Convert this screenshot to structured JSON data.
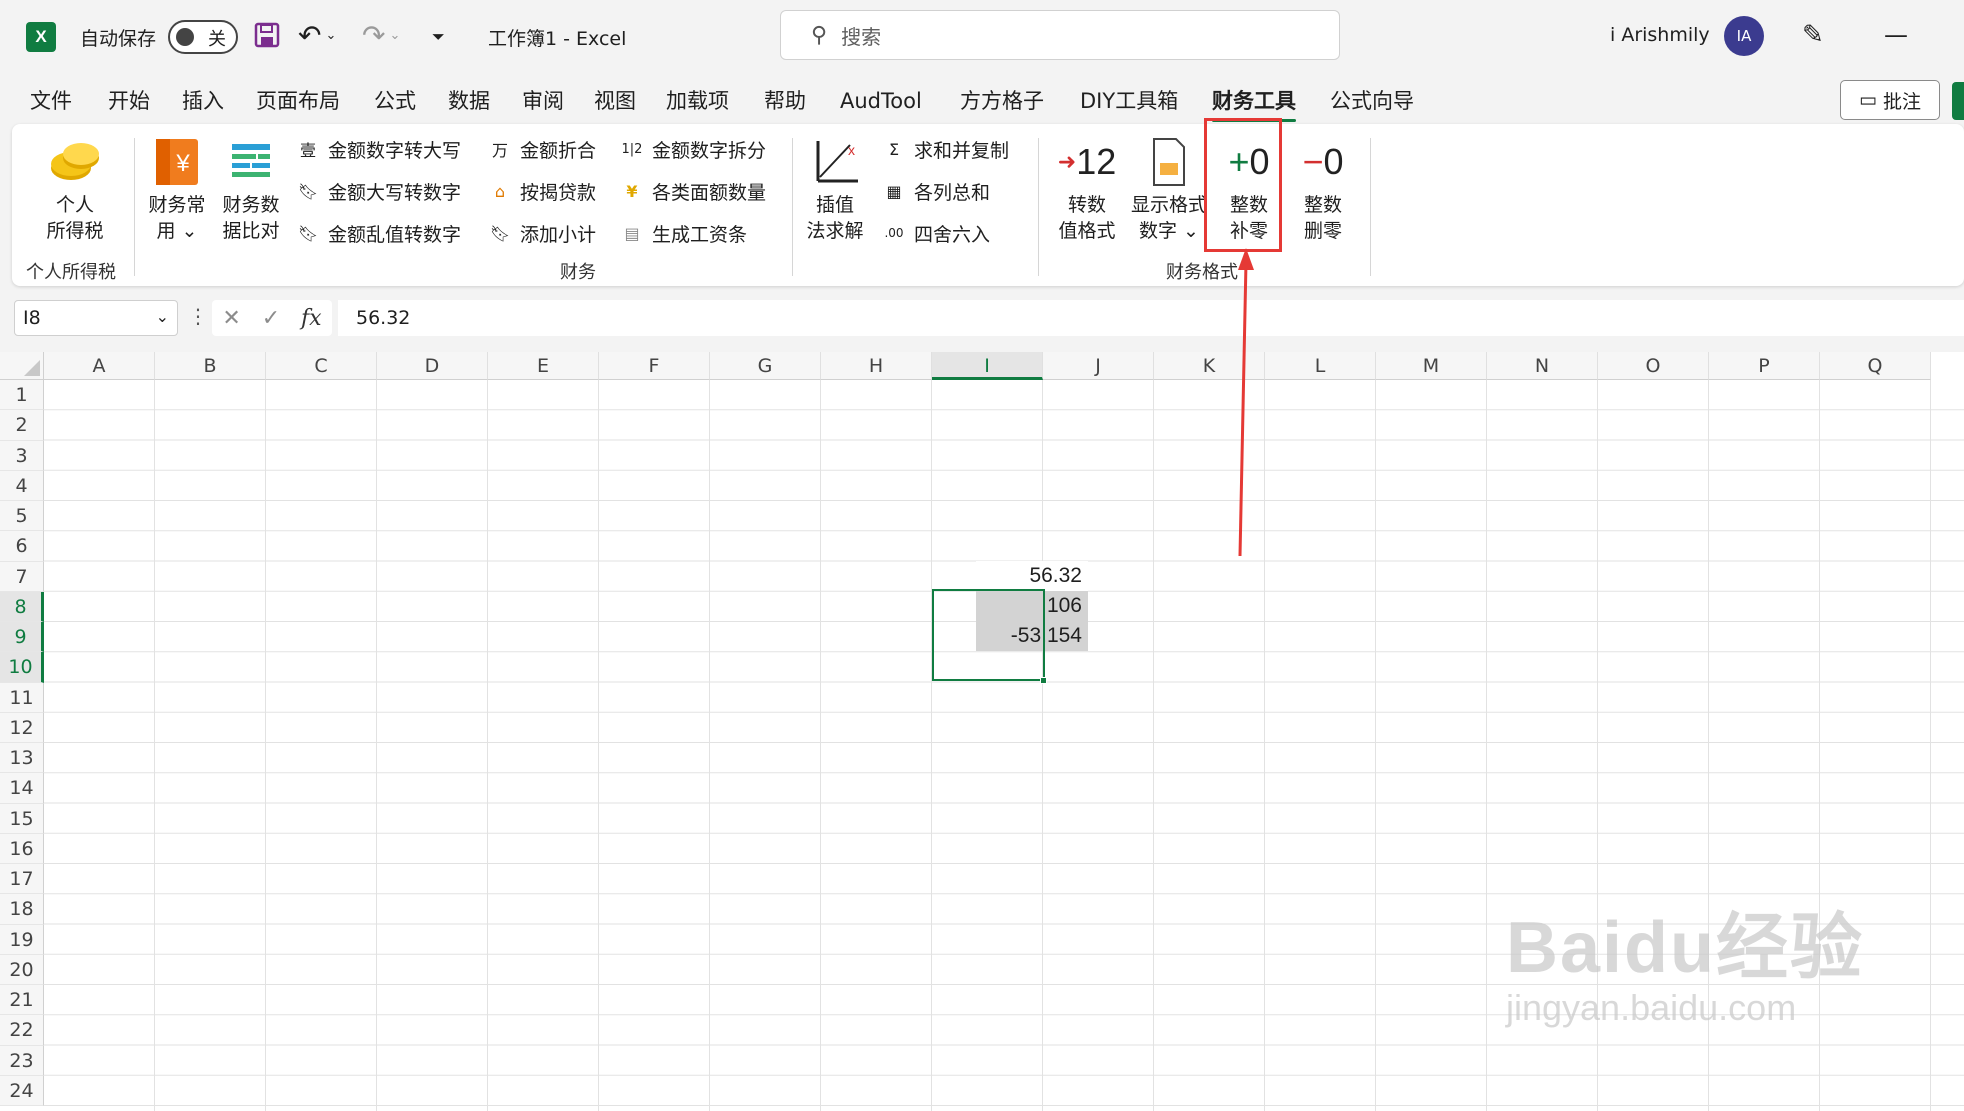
{
  "titlebar": {
    "logo_letter": "X",
    "autosave_label": "自动保存",
    "autosave_state": "关",
    "doc_title": "工作簿1  -  Excel",
    "search_placeholder": "搜索",
    "user_name": "i Arishmily",
    "user_initials": "IA"
  },
  "menu": {
    "items": [
      "文件",
      "开始",
      "插入",
      "页面布局",
      "公式",
      "数据",
      "审阅",
      "视图",
      "加载项",
      "帮助",
      "AudTool",
      "方方格子",
      "DIY工具箱",
      "财务工具",
      "公式向导"
    ],
    "active": "财务工具",
    "comment_button": "批注"
  },
  "ribbon": {
    "personal_tax": {
      "label1": "个人",
      "label2": "所得税",
      "group": "个人所得税"
    },
    "finance_common": {
      "label1": "财务常",
      "label2": "用"
    },
    "finance_compare": {
      "label1": "财务数",
      "label2": "据比对"
    },
    "small_col1": [
      "金额数字转大写",
      "金额大写转数字",
      "金额乱值转数字"
    ],
    "small_col2": [
      "金额折合",
      "按揭贷款",
      "添加小计"
    ],
    "small_col3": [
      "金额数字拆分",
      "各类面额数量",
      "生成工资条"
    ],
    "finance_group": "财务",
    "interp": {
      "label1": "插值",
      "label2": "法求解"
    },
    "small_col4": [
      "求和并复制",
      "各列总和",
      "四舍六入"
    ],
    "to_number": {
      "big": "12",
      "label1": "转数",
      "label2": "值格式"
    },
    "display_format": {
      "label1": "显示格式",
      "label2": "数字"
    },
    "int_pad": {
      "big": "0",
      "label1": "整数",
      "label2": "补零"
    },
    "int_trim": {
      "big": "0",
      "label1": "整数",
      "label2": "删零"
    },
    "format_group": "财务格式"
  },
  "formula_bar": {
    "name_box": "I8",
    "fx": "fx",
    "value": "56.32"
  },
  "sheet": {
    "columns": [
      "A",
      "B",
      "C",
      "D",
      "E",
      "F",
      "G",
      "H",
      "I",
      "J",
      "K",
      "L",
      "M",
      "N",
      "O",
      "P",
      "Q"
    ],
    "rows": [
      "1",
      "2",
      "3",
      "4",
      "5",
      "6",
      "7",
      "8",
      "9",
      "10",
      "11",
      "12",
      "13",
      "14",
      "15",
      "16",
      "17",
      "18",
      "19",
      "20",
      "21",
      "22",
      "23",
      "24"
    ],
    "selected_column": "I",
    "selected_rows": [
      "8",
      "9",
      "10"
    ],
    "cells": {
      "I8": "56.32",
      "I9": "106",
      "I10": "-53.154"
    }
  },
  "annotation": {
    "color": "#e53935"
  },
  "watermark": {
    "line1": "Baidu经验",
    "line2": "jingyan.baidu.com"
  },
  "colors": {
    "accent": "#107c41",
    "highlight": "#e53935"
  }
}
